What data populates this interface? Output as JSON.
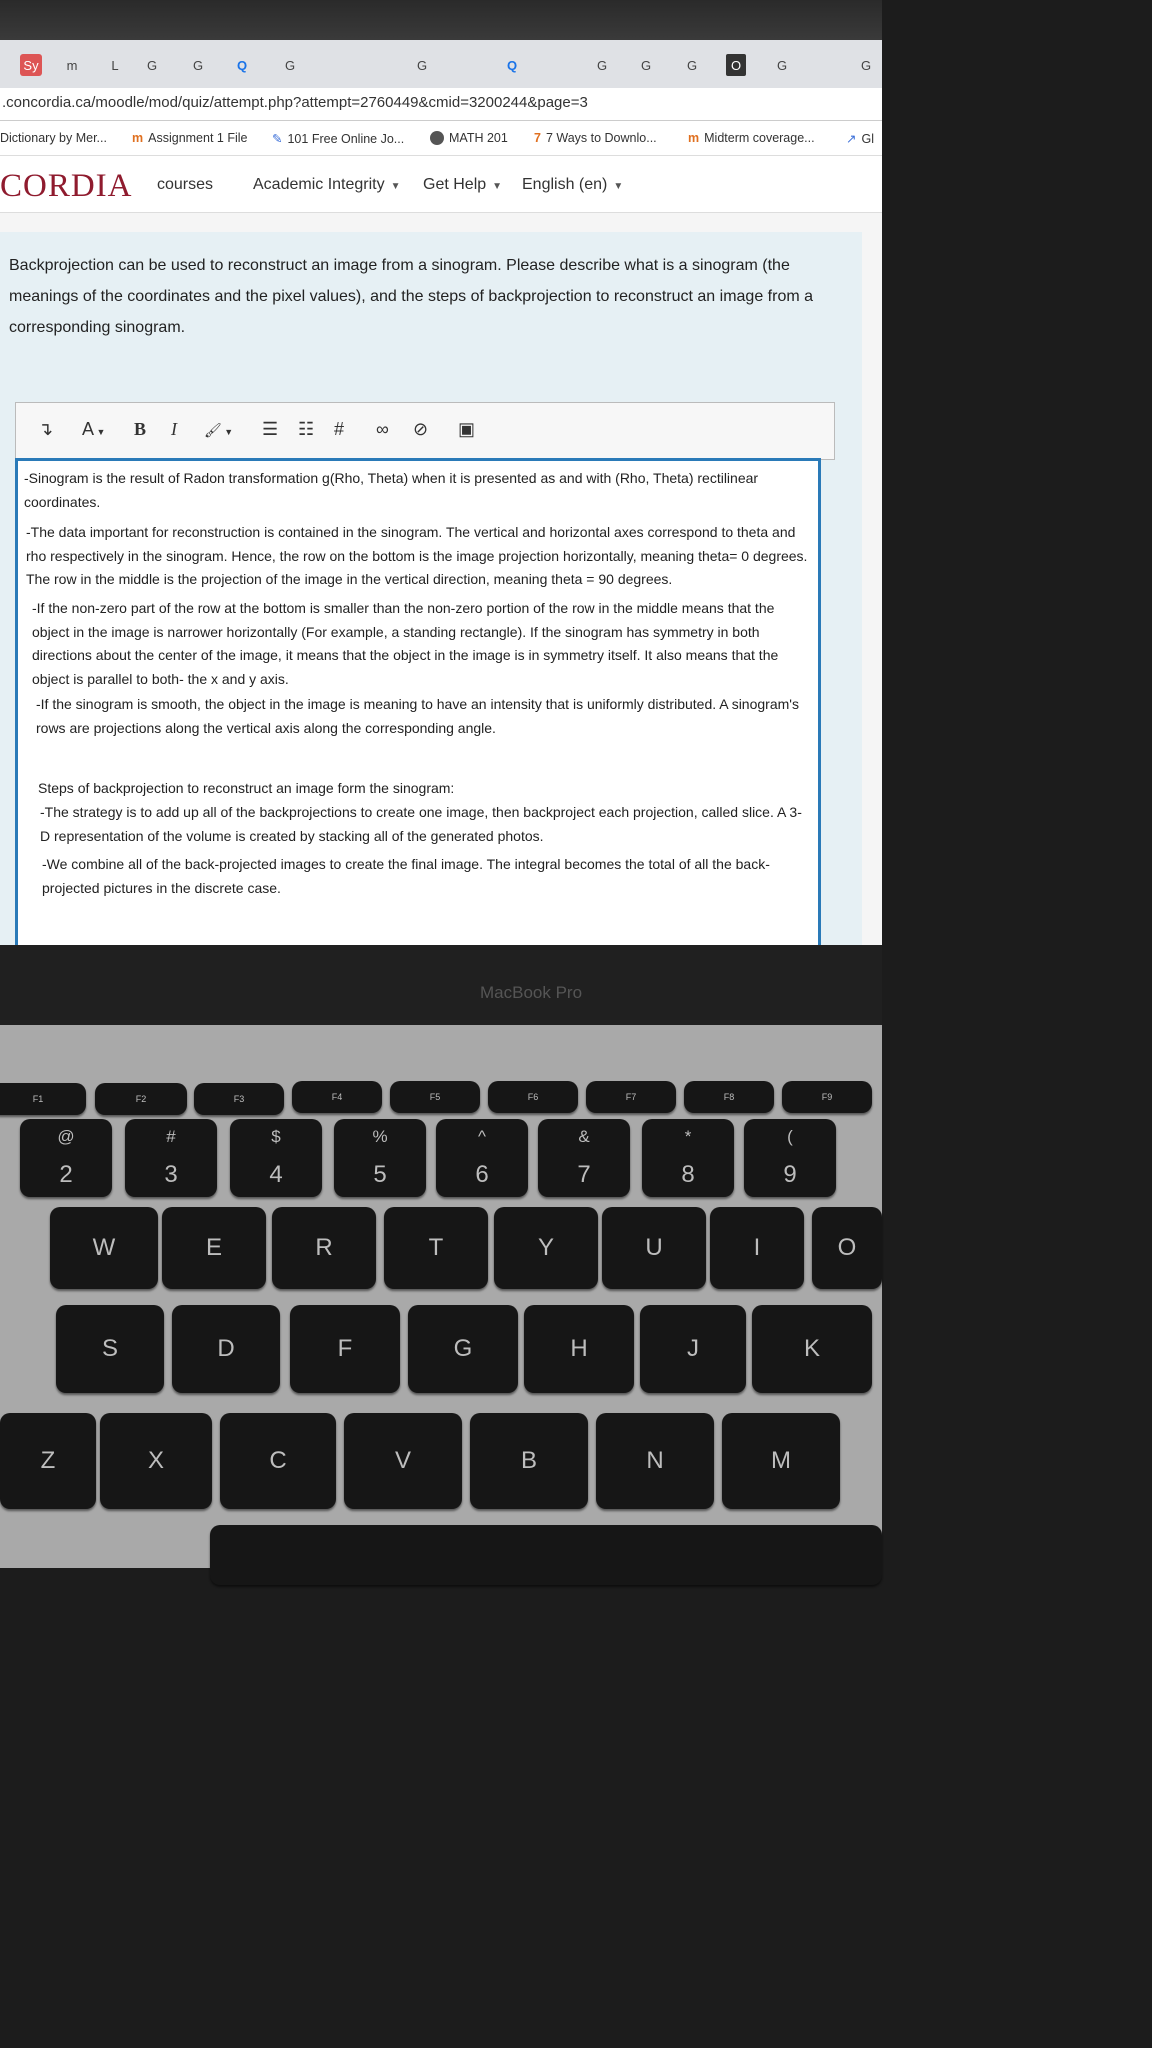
{
  "browser": {
    "tab_labels": [
      "Sy",
      "m",
      "L",
      "G",
      "G",
      "Q",
      "G",
      "G",
      "Q",
      "G",
      "G",
      "G",
      "O",
      "G",
      "G"
    ],
    "url": ".concordia.ca/moodle/mod/quiz/attempt.php?attempt=2760449&cmid=3200244&page=3",
    "bookmarks": [
      "Dictionary by Mer...",
      "Assignment 1 File",
      "101 Free Online Jo...",
      "MATH 201",
      "7 Ways to Downlo...",
      "Midterm coverage...",
      "Gl"
    ]
  },
  "nav": {
    "logo": "CORDIA",
    "courses": "courses",
    "academic_integrity": "Academic Integrity",
    "get_help": "Get Help",
    "language": "English (en)"
  },
  "question": {
    "text": "Backprojection can be used to reconstruct an image from a sinogram. Please describe what is a sinogram (the meanings of the coordinates and the pixel values), and the steps of backprojection to reconstruct an image from a corresponding sinogram."
  },
  "editor": {
    "toolbar": [
      "↴",
      "A",
      "B",
      "I",
      "🖌",
      "list-bullets",
      "list-numbers",
      "#",
      "link",
      "unlink",
      "image"
    ],
    "p1": "-Sinogram is the result of Radon transformation g(Rho, Theta) when it is presented as and with (Rho, Theta) rectilinear coordinates.",
    "p2": "-The data important for reconstruction is contained in the sinogram. The vertical and horizontal axes correspond to theta and rho respectively in the sinogram. Hence, the row on the bottom is the image projection horizontally, meaning theta= 0 degrees. The row in the middle is the projection of the image in the vertical direction, meaning theta = 90 degrees.",
    "p3": "-If the non-zero part of the row at the bottom is smaller than the non-zero portion of the row in the middle means that the object in the image is narrower horizontally (For example, a standing rectangle). If the sinogram has symmetry in both directions about the center of the image, it means that the object in the image is in symmetry itself. It also means that the object is parallel to both- the x and y axis.",
    "p4": "-If the sinogram is smooth, the object in the image is meaning to have an intensity that is uniformly distributed. A sinogram's rows are projections along the vertical axis along the corresponding angle.",
    "p5": "Steps of backprojection to reconstruct an image form the sinogram:",
    "p6": "-The strategy is to add up all of the backprojections to create one image, then backproject each projection, called slice. A 3-D representation of the volume is created by stacking all of the generated photos.",
    "p7": "-We combine all of the back-projected images to create the final image. The integral becomes the total of all the back-projected pictures in the discrete case."
  },
  "laptop": {
    "label": "MacBook Pro",
    "fkeys": [
      "F1",
      "F2",
      "F3",
      "F4",
      "F5",
      "F6",
      "F7",
      "F8",
      "F9"
    ],
    "number_row": [
      [
        "@",
        "2"
      ],
      [
        "#",
        "3"
      ],
      [
        "$",
        "4"
      ],
      [
        "%",
        "5"
      ],
      [
        "^",
        "6"
      ],
      [
        "&",
        "7"
      ],
      [
        "*",
        "8"
      ],
      [
        "(",
        "9"
      ]
    ],
    "row_q": [
      "W",
      "E",
      "R",
      "T",
      "Y",
      "U",
      "I",
      "O"
    ],
    "row_a": [
      "S",
      "D",
      "F",
      "G",
      "H",
      "J",
      "K"
    ],
    "row_z": [
      "Z",
      "X",
      "C",
      "V",
      "B",
      "N",
      "M"
    ]
  }
}
